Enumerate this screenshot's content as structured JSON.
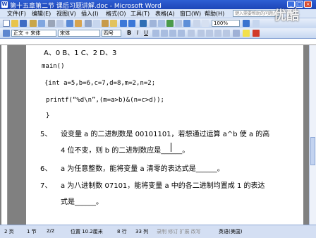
{
  "window": {
    "title": "第十五章第二节 课后习题讲解.doc - Microsoft Word",
    "watermark": "优酷"
  },
  "menu": {
    "items": [
      "文件(F)",
      "编辑(E)",
      "视图(V)",
      "插入(I)",
      "格式(O)",
      "工具(T)",
      "表格(A)",
      "窗口(W)",
      "帮助(H)"
    ],
    "help_placeholder": "键入需要帮助的问题"
  },
  "toolbar": {
    "zoom": "100%",
    "style": "正文 + 宋体",
    "font": "宋体",
    "size": "四号"
  },
  "document": {
    "line_options": "A、0          B、1          C、2          D、3",
    "code": {
      "main": "main()",
      "decl": "{int  a=5,b=6,c=7,d=8,m=2,n=2;",
      "printf": "printf(“%d\\n”,(m=a>b)&(n=c>d));",
      "close": "}"
    },
    "q5": {
      "num": "5、",
      "text1": "设变量 a 的二进制数是 00101101，若想通过运算 a^b 使 a 的高",
      "text2": "4 位不变，则 b 的二进制数应是______。"
    },
    "q6": {
      "num": "6、",
      "text": "a 为任意整数，能将变量 a 清零的表达式是______。"
    },
    "q7": {
      "num": "7、",
      "text1": "a 为八进制数 07101，能将变量 a 中的各二进制均置成 1 的表达",
      "text2": "式是______。"
    }
  },
  "status": {
    "page": "2 页",
    "section": "1 节",
    "pages": "2/2",
    "position": "位置 10.2厘米",
    "line": "8 行",
    "col": "33 列",
    "modes": "录制  修订  扩展  改写",
    "lang": "英语(美国)",
    "draw": "绘图(R)",
    "autoshape": "自选图形(U)"
  }
}
